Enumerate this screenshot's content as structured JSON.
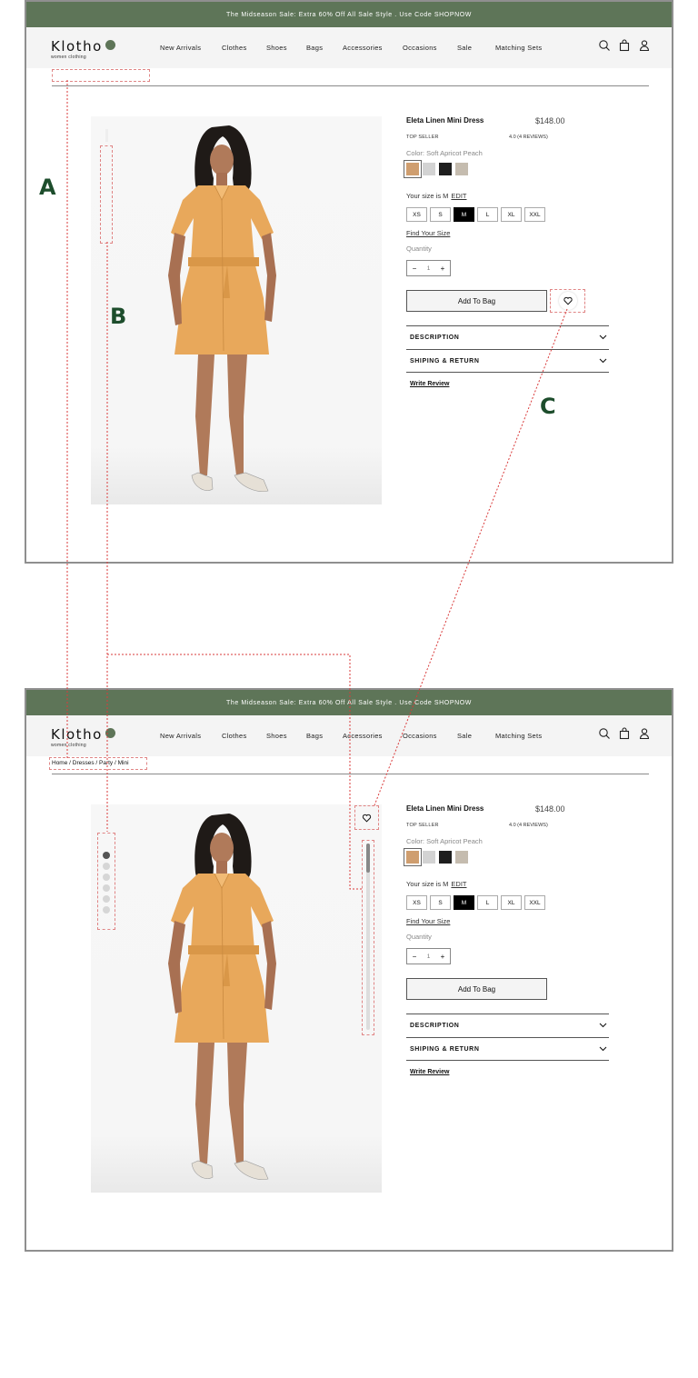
{
  "banner": "The Midseason Sale: Extra 60% Off All Sale Style . Use Code SHOPNOW",
  "brand": {
    "name": "Klotho",
    "tagline": "women clothing"
  },
  "nav": [
    "New Arrivals",
    "Clothes",
    "Shoes",
    "Bags",
    "Accessories",
    "Occasions",
    "Sale",
    "Matching Sets"
  ],
  "icons": {
    "search": "search-icon",
    "bag": "shopping-bag-icon",
    "account": "user-icon",
    "wishlist": "heart-icon",
    "accordion": "chevron-down-icon"
  },
  "breadcrumb": "Home / Dresses / Party / Mini",
  "product": {
    "title": "Eleta Linen Mini Dress",
    "price": "$148.00",
    "badge": "TOP SELLER",
    "rating": "4.0 (4 REVIEWS)",
    "color_label": "Color: Soft Apricot Peach",
    "swatches": [
      "#cf9e6f",
      "#d3d3d3",
      "#1e1e1e",
      "#c5bcaf"
    ],
    "size_prefix": "Your size is M",
    "size_edit": "EDIT",
    "sizes": [
      "XS",
      "S",
      "M",
      "L",
      "XL",
      "XXL"
    ],
    "selected_size": "M",
    "find_size": "Find Your Size",
    "quantity_label": "Quantity",
    "quantity": "1",
    "minus": "−",
    "plus": "+",
    "add_to_bag": "Add To Bag",
    "accordions": [
      "DESCRIPTION",
      "SHIPING & RETURN"
    ],
    "write_review": "Write Review"
  },
  "image_dots": {
    "count": 6,
    "active": 0
  },
  "callouts": {
    "a": "A",
    "b": "B",
    "c": "C"
  },
  "colors": {
    "banner": "#5e7558",
    "callout": "#1d4d2c",
    "annotation": "#e08585"
  }
}
